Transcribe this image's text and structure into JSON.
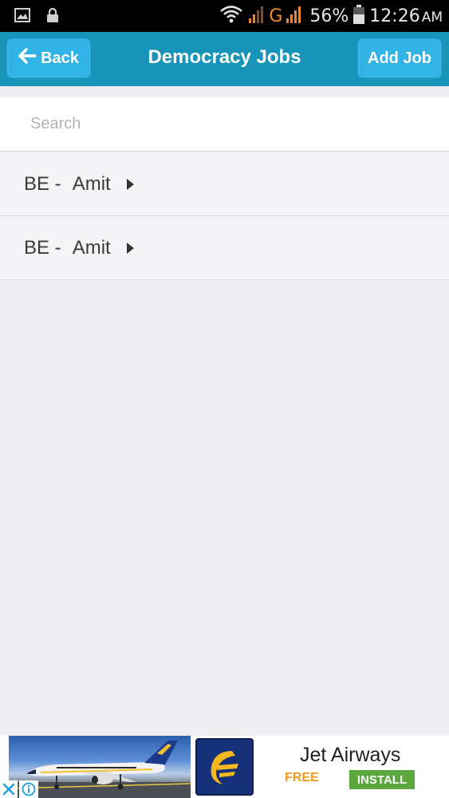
{
  "status_bar": {
    "battery_percent": "56%",
    "time": "12:26",
    "ampm": "AM",
    "network_type": "G",
    "icons": [
      "image-icon",
      "lock-icon",
      "wifi-icon",
      "signal-icon",
      "signal-icon",
      "battery-icon"
    ]
  },
  "header": {
    "back_label": "Back",
    "title": "Democracy Jobs",
    "add_label": "Add Job",
    "background": "#1794b8",
    "button_color": "#31b3e5"
  },
  "search": {
    "placeholder": "Search",
    "value": ""
  },
  "jobs": [
    {
      "code": "BE",
      "separator": " -",
      "name": "Amit"
    },
    {
      "code": "BE",
      "separator": " -",
      "name": "Amit"
    }
  ],
  "ad": {
    "title": "Jet Airways",
    "free_label": "FREE",
    "install_label": "INSTALL",
    "install_color": "#5aa83c",
    "free_color": "#f29a1d"
  }
}
